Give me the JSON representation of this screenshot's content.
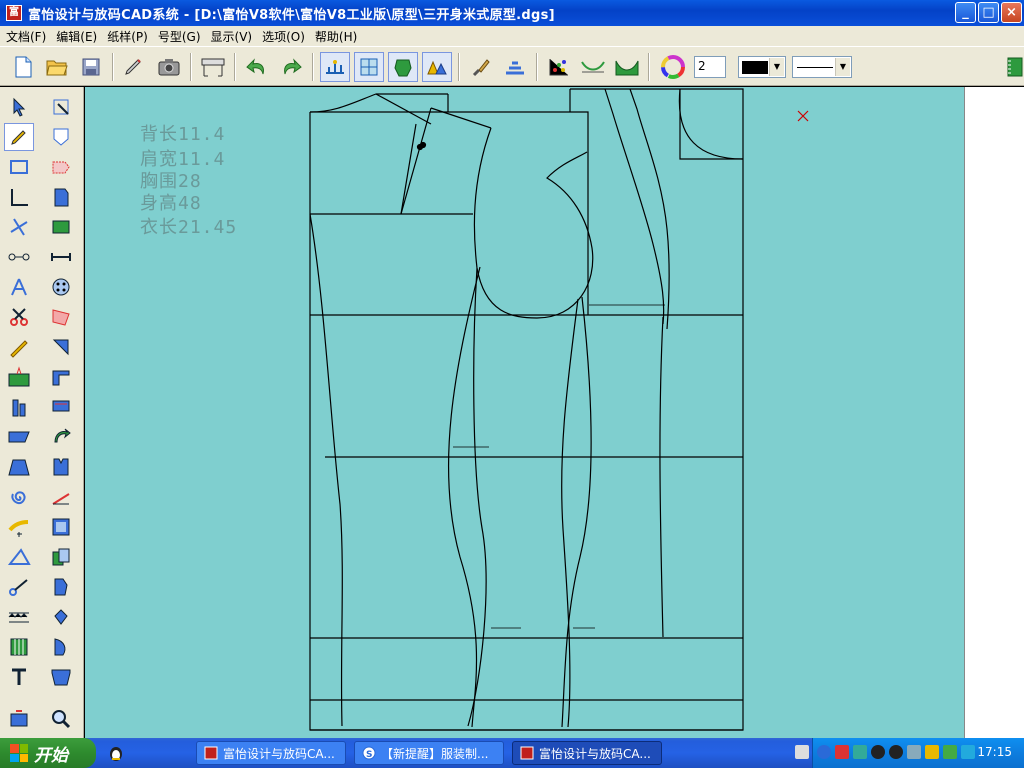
{
  "titlebar": {
    "title": "富怡设计与放码CAD系统 - [D:\\富怡V8软件\\富怡V8工业版\\原型\\三开身米式原型.dgs]",
    "minimize": "_",
    "maximize": "□",
    "close": "×"
  },
  "menu": [
    "文档(F)",
    "编辑(E)",
    "纸样(P)",
    "号型(G)",
    "显示(V)",
    "选项(O)",
    "帮助(H)"
  ],
  "toolbar": {
    "number_value": "2",
    "icons": [
      "new-file-icon",
      "open-folder-icon",
      "save-icon",
      "pencil-icon",
      "camera-icon",
      "plotter-icon",
      "undo-icon",
      "redo-icon",
      "size-table-icon",
      "grid-icon",
      "pattern-shape-icon",
      "pieces-icon",
      "brush-icon",
      "grading-icon",
      "color-points-icon",
      "lines-icon",
      "seam-icon",
      "color-wheel-icon"
    ]
  },
  "measurements": [
    "背长11.4",
    "肩宽11.4",
    "胸围28",
    "身高48",
    "衣长21.45"
  ],
  "taskbar": {
    "start_label": "开始",
    "tasks": [
      "富怡设计与放码CA...",
      "【新提醒】服装制...",
      "富怡设计与放码CA..."
    ],
    "clock": "17:15"
  },
  "colors": {
    "canvas": "#7fcfcf",
    "measure_text": "#6a9a9a",
    "lines": "#000000",
    "marker": "#cc0000"
  }
}
